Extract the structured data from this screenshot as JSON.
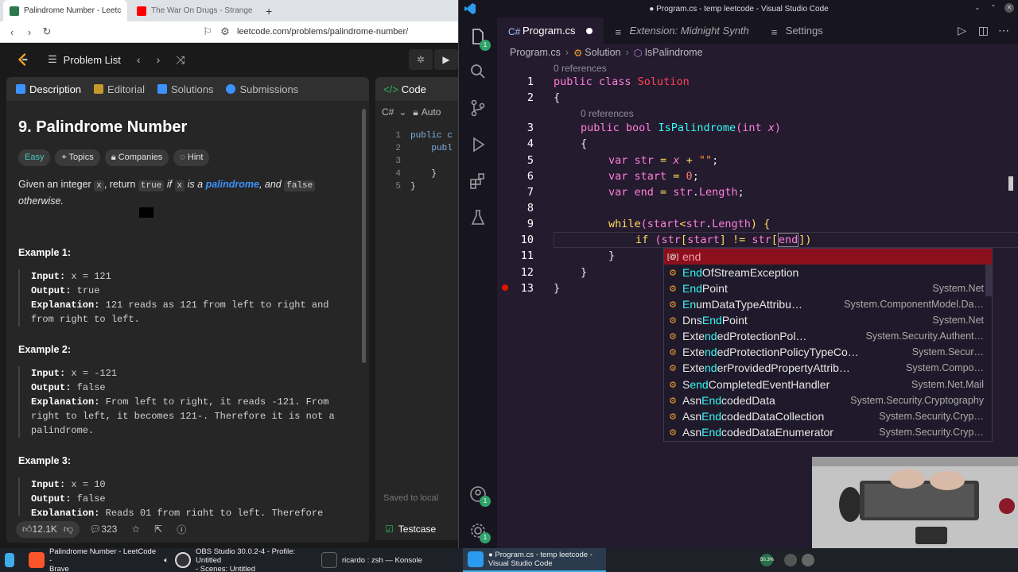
{
  "browser": {
    "tabs": [
      {
        "title": "Palindrome Number - Leetc",
        "active": true
      },
      {
        "title": "The War On Drugs - Strange",
        "active": false
      }
    ],
    "new_tab": "+",
    "url": "leetcode.com/problems/palindrome-number/"
  },
  "leetcode": {
    "header": {
      "problem_list": "Problem List",
      "prev": "‹",
      "next": "›",
      "shuffle": "⤨"
    },
    "tabs": [
      "Description",
      "Editorial",
      "Solutions",
      "Submissions"
    ],
    "title": "9. Palindrome Number",
    "tags": [
      "Easy",
      "Topics",
      "Companies",
      "Hint"
    ],
    "description": {
      "p1": "Given an integer",
      "x": "x",
      "p2": ", return",
      "true": "true",
      "p3": "if",
      "p4": "is a",
      "link": "palindrome",
      "p5": ", and",
      "false": "false",
      "p6": "otherwise."
    },
    "examples": [
      {
        "heading": "Example 1:",
        "input": "x = 121",
        "output": "true",
        "explanation": "121 reads as 121 from left to right and from right to left."
      },
      {
        "heading": "Example 2:",
        "input": "x = -121",
        "output": "false",
        "explanation": "From left to right, it reads -121. From right to left, it becomes 121-. Therefore it is not a palindrome."
      },
      {
        "heading": "Example 3:",
        "input": "x = 10",
        "output": "false",
        "explanation": "Reads 01 from right to left. Therefore"
      }
    ],
    "labels": {
      "input": "Input:",
      "output": "Output:",
      "explanation": "Explanation:"
    },
    "footer": {
      "likes": "12.1K",
      "comments": "323"
    },
    "code_panel": {
      "title": "Code",
      "lang": "C#",
      "auto": "Auto",
      "lines": [
        "public c",
        "    publ",
        "",
        "    }",
        "}"
      ],
      "saved": "Saved to local",
      "testcase": "Testcase"
    }
  },
  "vscode": {
    "window_title": "● Program.cs - temp leetcode - Visual Studio Code",
    "tabs": [
      {
        "label": "Program.cs",
        "active": true,
        "modified": true
      },
      {
        "label": "Extension: Midnight Synth",
        "active": false
      },
      {
        "label": "Settings",
        "active": false
      }
    ],
    "breadcrumbs": [
      "Program.cs",
      "Solution",
      "IsPalindrome"
    ],
    "references": "0 references",
    "code": {
      "l1a": "public class ",
      "l1b": "Solution",
      "l2": "{",
      "l3a": "public bool ",
      "l3b": "IsPalindrome",
      "l3c": "(int ",
      "l3d": "x",
      "l3e": ")",
      "l4": "{",
      "l5a": "var ",
      "l5b": "str",
      "l5c": " = ",
      "l5d": "x",
      "l5e": " + ",
      "l5f": "\"\"",
      "l5g": ";",
      "l6a": "var ",
      "l6b": "start",
      "l6c": " = ",
      "l6d": "0",
      "l6e": ";",
      "l7a": "var ",
      "l7b": "end",
      "l7c": " = ",
      "l7d": "str",
      "l7e": ".",
      "l7f": "Length",
      "l7g": ";",
      "l9a": "while",
      "l9b": "(",
      "l9c": "start",
      "l9d": "<",
      "l9e": "str",
      "l9f": ".",
      "l9g": "Length",
      "l9h": ") {",
      "l10a": "if",
      "l10b": " (",
      "l10c": "str",
      "l10d": "[",
      "l10e": "start",
      "l10f": "] != ",
      "l10g": "str",
      "l10h": "[",
      "l10i": "end",
      "l10j": "])",
      "l11": "}",
      "l12": "}",
      "l13": "}"
    },
    "line_numbers": [
      "1",
      "2",
      "3",
      "4",
      "5",
      "6",
      "7",
      "8",
      "9",
      "10",
      "11",
      "12",
      "13"
    ],
    "suggestions": [
      {
        "pre": "",
        "match": "end",
        "post": "",
        "detail": "",
        "icon": "[@]"
      },
      {
        "pre": "",
        "match": "End",
        "post": "OfStreamException",
        "detail": "",
        "icon": "⚙"
      },
      {
        "pre": "",
        "match": "End",
        "post": "Point",
        "detail": "System.Net",
        "icon": "⚙"
      },
      {
        "pre": "",
        "match": "En",
        "post": "umDataTypeAttribu…",
        "detail": "System.ComponentModel.Da…",
        "icon": "⚙"
      },
      {
        "pre": "Dns",
        "match": "End",
        "post": "Point",
        "detail": "System.Net",
        "icon": "⚙"
      },
      {
        "pre": "Exte",
        "match": "nd",
        "post": "edProtectionPol…",
        "detail": "System.Security.Authent…",
        "icon": "⚙"
      },
      {
        "pre": "Exte",
        "match": "nd",
        "post": "edProtectionPolicyTypeCo…",
        "detail": "System.Secur…",
        "icon": "⚙"
      },
      {
        "pre": "Exte",
        "match": "nd",
        "post": "erProvidedPropertyAttrib…",
        "detail": "System.Compo…",
        "icon": "⚙"
      },
      {
        "pre": "S",
        "match": "end",
        "post": "CompletedEventHandler",
        "detail": "System.Net.Mail",
        "icon": "⚙"
      },
      {
        "pre": "Asn",
        "match": "End",
        "post": "codedData",
        "detail": "System.Security.Cryptography",
        "icon": "⚙"
      },
      {
        "pre": "Asn",
        "match": "End",
        "post": "codedDataCollection",
        "detail": "System.Security.Cryp…",
        "icon": "⚙"
      },
      {
        "pre": "Asn",
        "match": "End",
        "post": "codedDataEnumerator",
        "detail": "System.Security.Cryp…",
        "icon": "⚙"
      }
    ],
    "badges": {
      "accounts": "1",
      "manage": "1"
    }
  },
  "taskbar": {
    "items": [
      {
        "line1": "Palindrome Number - LeetCode -",
        "line2": "Brave"
      },
      {
        "line1": "OBS Studio 30.0.2-4 - Profile: Untitled",
        "line2": "- Scenes: Untitled"
      },
      {
        "line1": "ricardo : zsh — Konsole",
        "line2": ""
      },
      {
        "line1": "● Program.cs - temp leetcode -",
        "line2": "Visual Studio Code"
      }
    ],
    "battery": "50.3%"
  },
  "colors": {
    "accent": "#3daee9",
    "leetcode_easy": "#46c6c2",
    "vscode_bg": "#241b2f",
    "suggest_selected": "#8b0f1d"
  }
}
